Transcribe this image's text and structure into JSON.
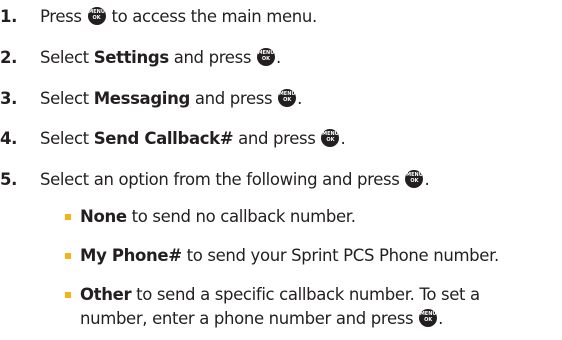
{
  "key_icon": {
    "name": "menu-ok-key-icon",
    "top_label": "MENU",
    "bottom_label": "OK"
  },
  "colors": {
    "text": "#231f20",
    "bullet": "#f7b216"
  },
  "steps": [
    {
      "number": "1.",
      "pre": "Press ",
      "bold": "",
      "mid": "",
      "post": " to access the main menu.",
      "key_pos": "inline",
      "end": ""
    },
    {
      "number": "2.",
      "pre": "Select ",
      "bold": "Settings",
      "mid": " and press ",
      "post": "",
      "end": "."
    },
    {
      "number": "3.",
      "pre": "Select ",
      "bold": "Messaging",
      "mid": " and press ",
      "post": "",
      "end": "."
    },
    {
      "number": "4.",
      "pre": "Select ",
      "bold": "Send Callback#",
      "mid": " and press ",
      "post": "",
      "end": "."
    },
    {
      "number": "5.",
      "pre": "Select an option from the following and press ",
      "bold": "",
      "mid": "",
      "post": "",
      "end": "."
    }
  ],
  "options": [
    {
      "bold": "None",
      "text": " to send no callback number."
    },
    {
      "bold": "My Phone#",
      "text": " to send your Sprint PCS Phone number."
    },
    {
      "bold": "Other",
      "text": " to send a specific callback number. To set a",
      "line2": "number, enter a phone number and press ",
      "end": "."
    }
  ]
}
